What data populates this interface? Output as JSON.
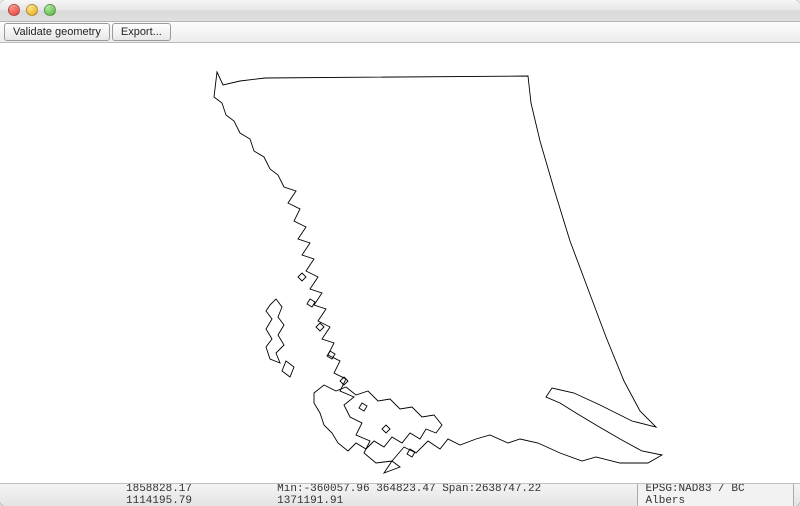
{
  "toolbar": {
    "validate_label": "Validate geometry",
    "export_label": "Export..."
  },
  "status": {
    "cursor_x": "1858828.17",
    "cursor_y": "1114195.79",
    "min_x": "-360057.96",
    "min_y": "364823.47",
    "span_x": "2638747.22",
    "span_y": "1371191.91",
    "crs": "EPSG:NAD83 / BC Albers"
  }
}
